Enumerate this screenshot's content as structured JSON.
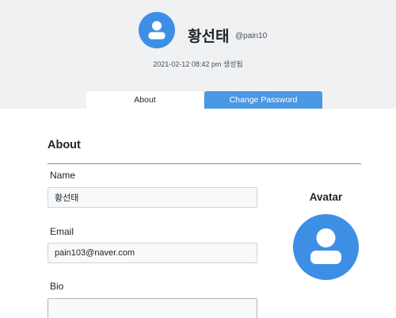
{
  "header": {
    "display_name": "황선태",
    "username": "@pain10",
    "created_at": "2021-02-12 08:42 pm",
    "created_suffix": "생성됨",
    "avatar_icon": "user-silhouette-icon",
    "avatar_color": "#3d8fe6"
  },
  "tabs": [
    {
      "label": "About",
      "active": true
    },
    {
      "label": "Change Password",
      "active": false,
      "color": "#4a97e2"
    }
  ],
  "about": {
    "title": "About",
    "fields": {
      "name": {
        "label": "Name",
        "value": "황선태"
      },
      "email": {
        "label": "Email",
        "value": "pain103@naver.com"
      },
      "bio": {
        "label": "Bio",
        "value": ""
      }
    },
    "avatar": {
      "heading": "Avatar",
      "icon": "user-silhouette-icon",
      "color": "#3d8fe6"
    }
  }
}
